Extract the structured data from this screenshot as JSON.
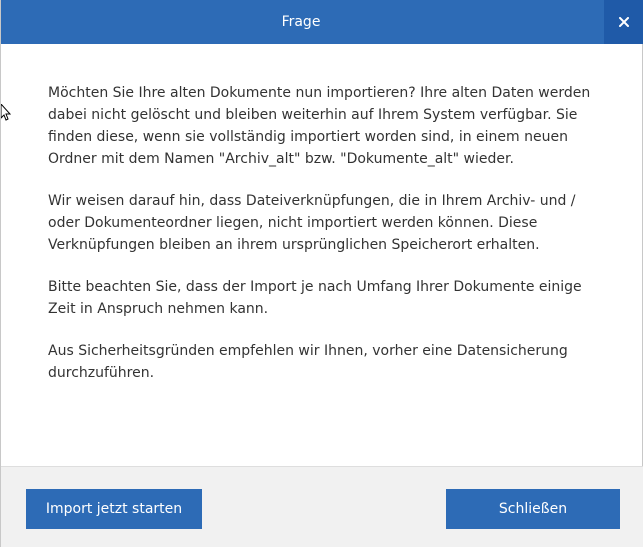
{
  "dialog": {
    "title": "Frage",
    "close_icon": "close-icon"
  },
  "message": {
    "paragraphs": [
      "Möchten Sie Ihre alten Dokumente nun importieren? Ihre alten Daten werden dabei nicht gelöscht und bleiben weiterhin auf Ihrem System verfügbar. Sie finden diese, wenn sie vollständig importiert worden sind, in einem neuen Ordner mit dem Namen \"Archiv_alt\" bzw. \"Dokumente_alt\" wieder.",
      "Wir weisen darauf hin, dass Dateiverknüpfungen, die in Ihrem Archiv- und / oder Dokumenteordner liegen, nicht importiert werden können. Diese Verknüpfungen bleiben an ihrem ursprünglichen Speicherort erhalten.",
      "Bitte beachten Sie, dass der Import je nach Umfang Ihrer Dokumente einige Zeit in Anspruch nehmen kann.",
      "Aus Sicherheitsgründen empfehlen wir Ihnen, vorher eine Datensicherung durchzuführen."
    ]
  },
  "footer": {
    "import_label": "Import jetzt starten",
    "close_label": "Schließen"
  },
  "colors": {
    "accent": "#2d6bb6",
    "close_button": "#1f5aa8",
    "footer_bg": "#f1f1f1",
    "text": "#333333"
  }
}
